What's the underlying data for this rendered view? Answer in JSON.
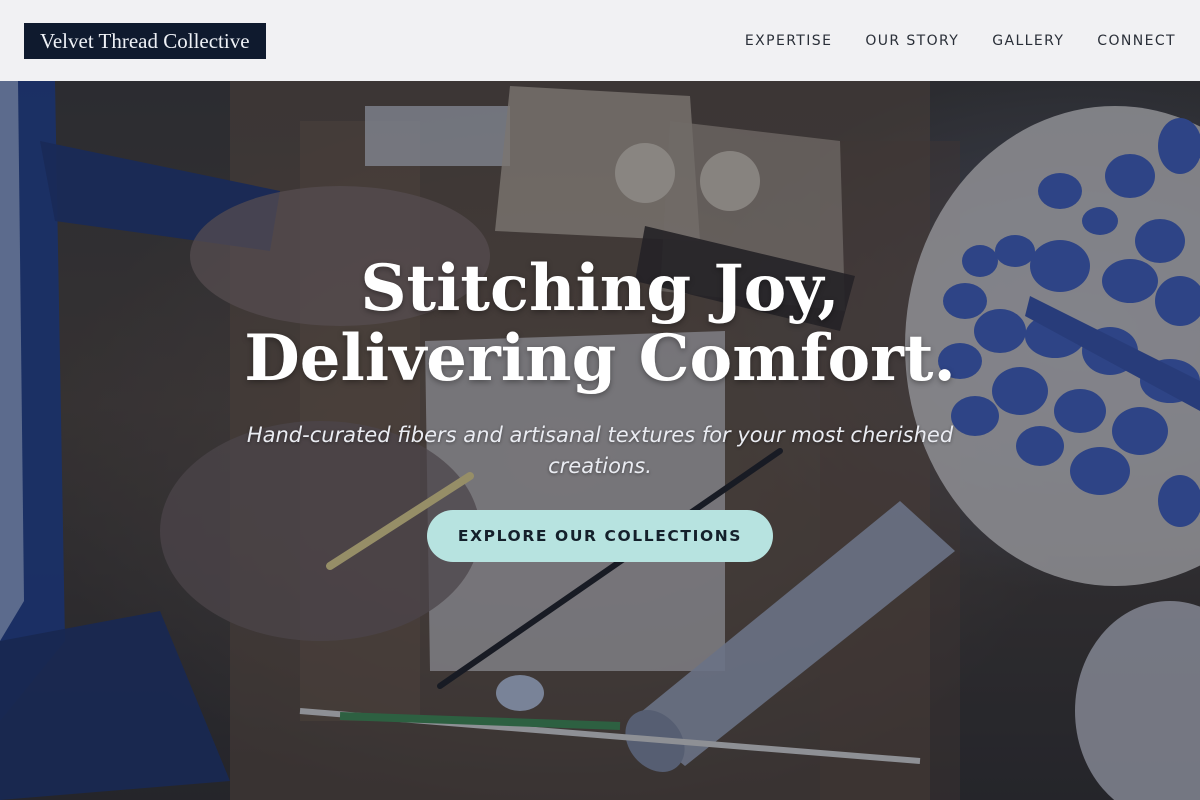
{
  "header": {
    "brand": "Velvet Thread Collective",
    "nav": [
      {
        "label": "EXPERTISE"
      },
      {
        "label": "OUR STORY"
      },
      {
        "label": "GALLERY"
      },
      {
        "label": "CONNECT"
      }
    ]
  },
  "hero": {
    "title_line1": "Stitching Joy,",
    "title_line2": "Delivering Comfort.",
    "subtitle": "Hand-curated fibers and artisanal textures for your most cherished creations.",
    "cta_label": "EXPLORE OUR COLLECTIONS",
    "background_description_icon": "craft-workbench-photo"
  },
  "colors": {
    "header_bg": "#f1f1f3",
    "logo_bg": "#0f1a2e",
    "cta_bg": "#b7e3e0",
    "overlay": "#141c30"
  }
}
